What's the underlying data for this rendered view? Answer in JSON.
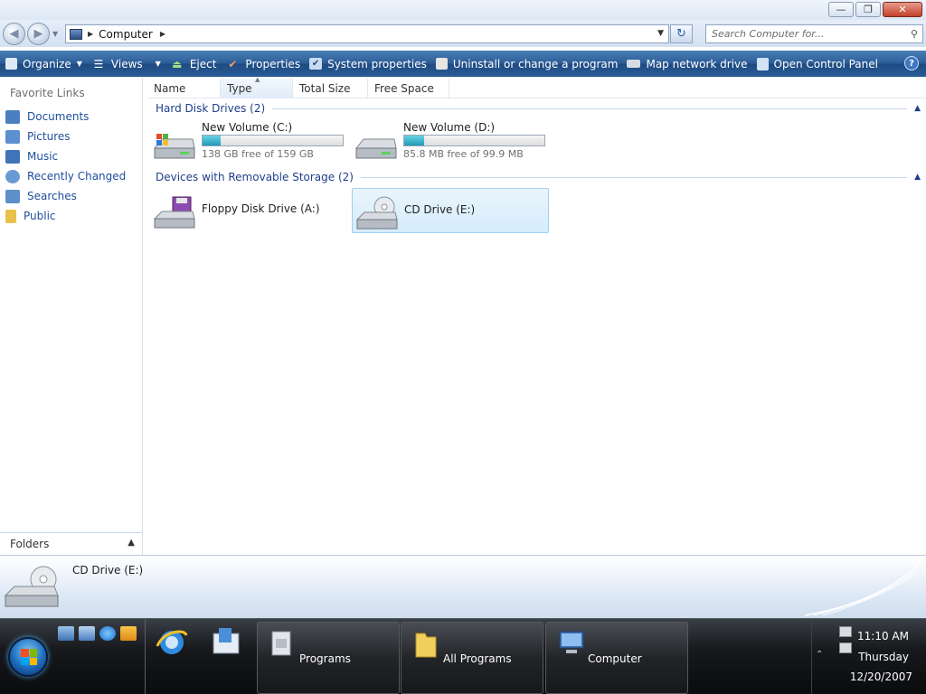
{
  "window": {
    "controls": {
      "minimize": "—",
      "maximize": "❐",
      "close": "✕"
    }
  },
  "navigation": {
    "back_icon": "back-arrow-icon",
    "forward_icon": "forward-arrow-icon",
    "address": {
      "crumb": "Computer"
    },
    "search": {
      "placeholder": "Search Computer for..."
    }
  },
  "commandbar": {
    "items": [
      {
        "label": "Organize",
        "icon": "organize-icon",
        "dropdown": true
      },
      {
        "label": "Views",
        "icon": "views-icon",
        "dropdown": true
      },
      {
        "label": "Eject",
        "icon": "eject-icon"
      },
      {
        "label": "Properties",
        "icon": "properties-icon"
      },
      {
        "label": "System properties",
        "icon": "system-properties-icon"
      },
      {
        "label": "Uninstall or change a program",
        "icon": "uninstall-icon"
      },
      {
        "label": "Map network drive",
        "icon": "map-network-drive-icon"
      },
      {
        "label": "Open Control Panel",
        "icon": "control-panel-icon"
      }
    ],
    "help": "?"
  },
  "sidebar": {
    "title": "Favorite Links",
    "items": [
      {
        "label": "Documents",
        "color": "#4b7fbf"
      },
      {
        "label": "Pictures",
        "color": "#5b8fcf"
      },
      {
        "label": "Music",
        "color": "#3f74b8"
      },
      {
        "label": "Recently Changed",
        "color": "#6a9ad4"
      },
      {
        "label": "Searches",
        "color": "#5d8fcb"
      },
      {
        "label": "Public",
        "color": "#e8c24a"
      }
    ],
    "folders_label": "Folders"
  },
  "columns": [
    "Name",
    "Type",
    "Total Size",
    "Free Space"
  ],
  "groups": [
    {
      "title": "Hard Disk Drives (2)",
      "items": [
        {
          "name": "New Volume (C:)",
          "free": "138 GB free of 159 GB",
          "used_fraction": 0.13
        },
        {
          "name": "New Volume (D:)",
          "free": "85.8 MB free of 99.9 MB",
          "used_fraction": 0.14
        }
      ]
    },
    {
      "title": "Devices with Removable Storage (2)",
      "items": [
        {
          "name": "Floppy Disk Drive (A:)"
        },
        {
          "name": "CD Drive (E:)",
          "selected": true
        }
      ]
    }
  ],
  "details": {
    "name": "CD Drive (E:)"
  },
  "taskbar": {
    "tasks": [
      {
        "label": "Programs"
      },
      {
        "label": "All Programs"
      },
      {
        "label": "Computer"
      }
    ],
    "clock": {
      "time": "11:10 AM",
      "day": "Thursday",
      "date": "12/20/2007"
    }
  }
}
